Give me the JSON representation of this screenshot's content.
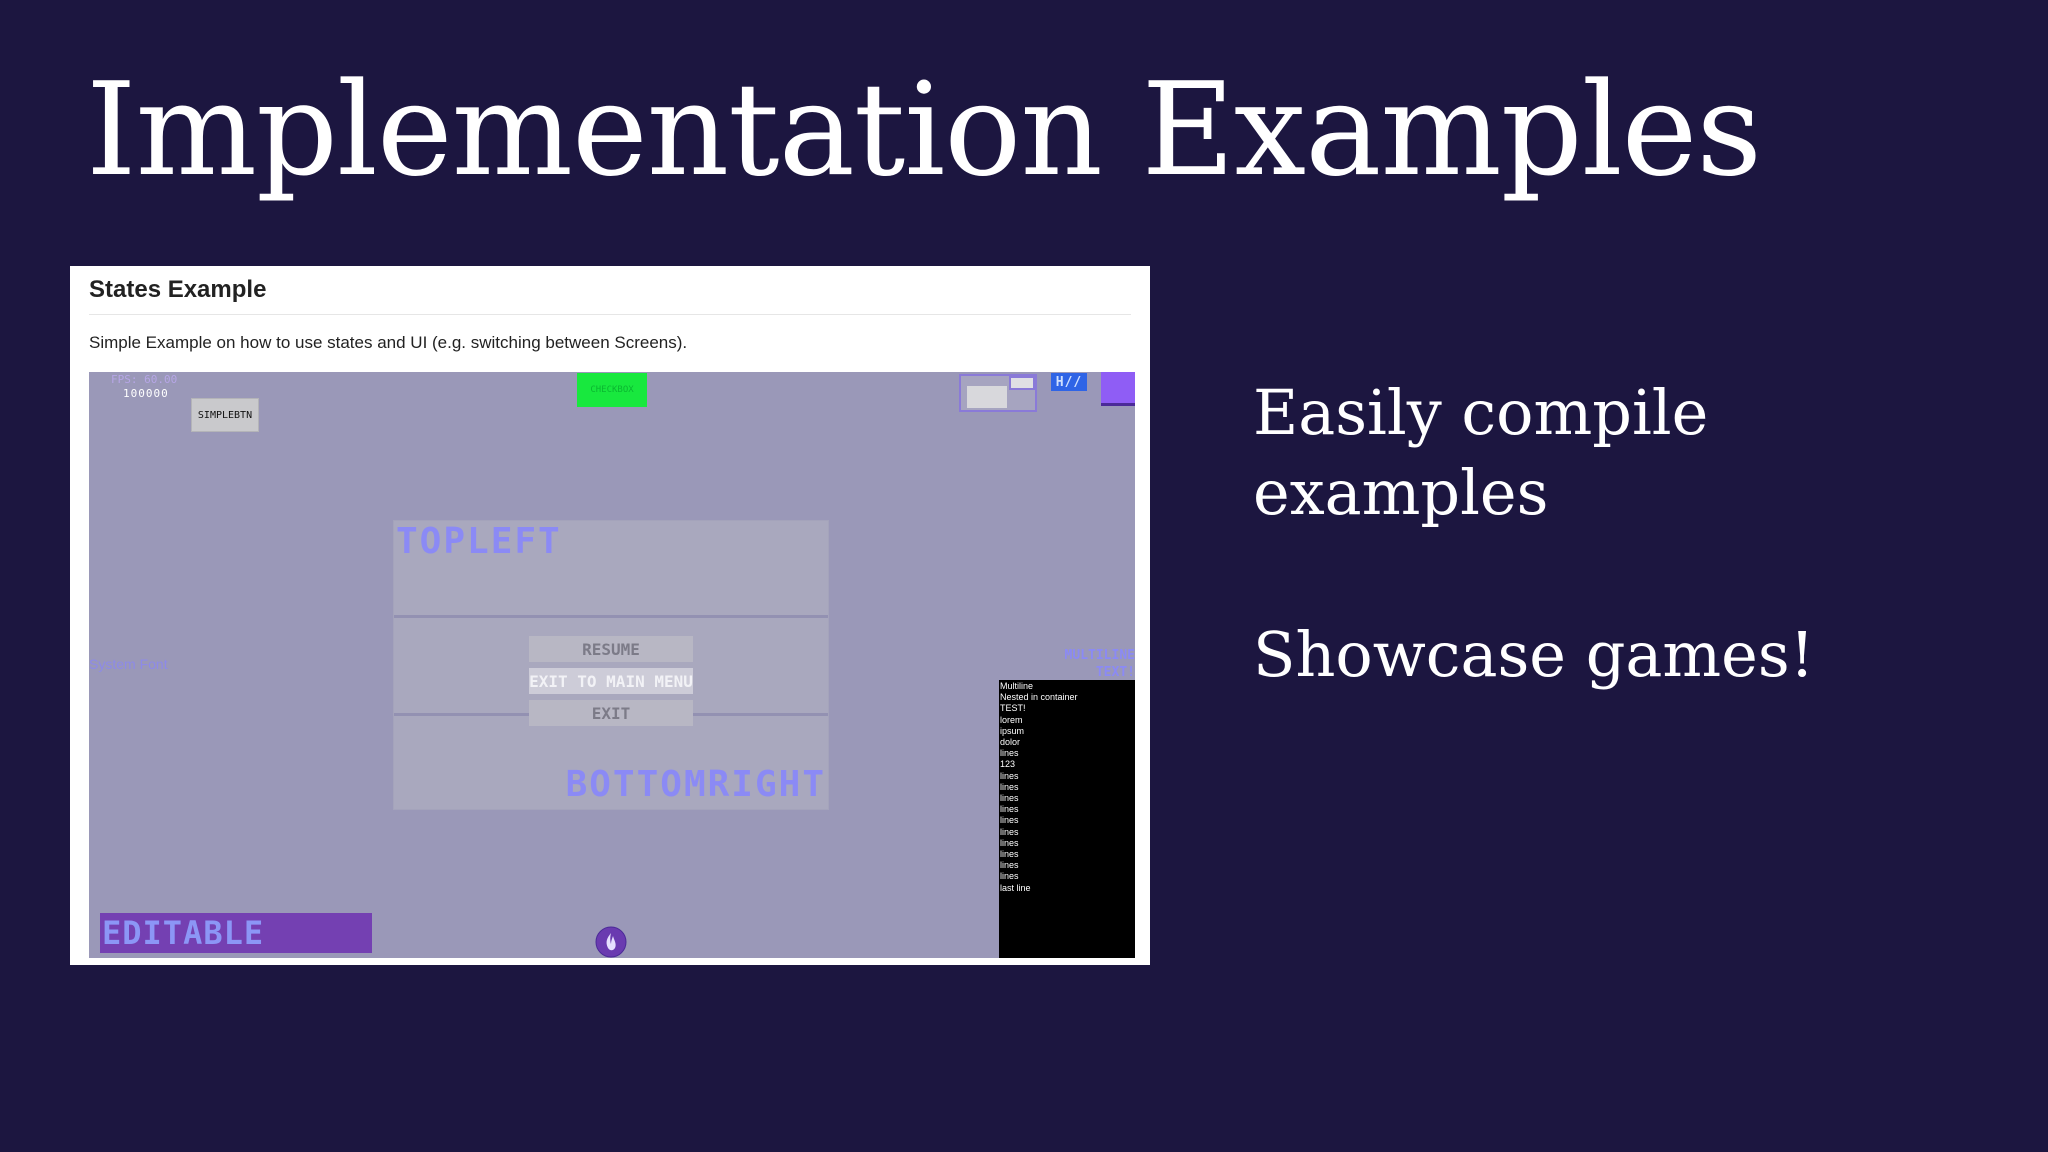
{
  "slide": {
    "title": "Implementation Examples",
    "bullets": [
      "Easily compile\nexamples",
      "Showcase games!"
    ]
  },
  "panel": {
    "title": "States Example",
    "description": "Simple Example on how to use states and UI (e.g. switching between Screens)."
  },
  "game": {
    "fps_label": "FPS: 60.00",
    "fps_value": "100000",
    "simple_button": "SIMPLEBTN",
    "green_button": "CHECKBOX",
    "blue_tag": "H//",
    "topleft": "TOPLEFT",
    "bottomright": "BOTTOMRIGHT",
    "menu": [
      "RESUME",
      "EXIT TO MAIN MENU",
      "EXIT"
    ],
    "system_font": "System Font",
    "multiline_title": "MULTILINE\nTEXT!",
    "terminal_lines": [
      "Multiline",
      "Nested in container",
      "TEST!",
      "lorem",
      "ipsum",
      "dolor",
      "lines",
      "123",
      "lines",
      "lines",
      "lines",
      "lines",
      "lines",
      "lines",
      "lines",
      "lines",
      "lines",
      "lines",
      "last line"
    ],
    "editable": "EDITABLE"
  },
  "colors": {
    "background": "#1c1640",
    "accent_purple": "#8f5df5",
    "green": "#18e83e"
  }
}
